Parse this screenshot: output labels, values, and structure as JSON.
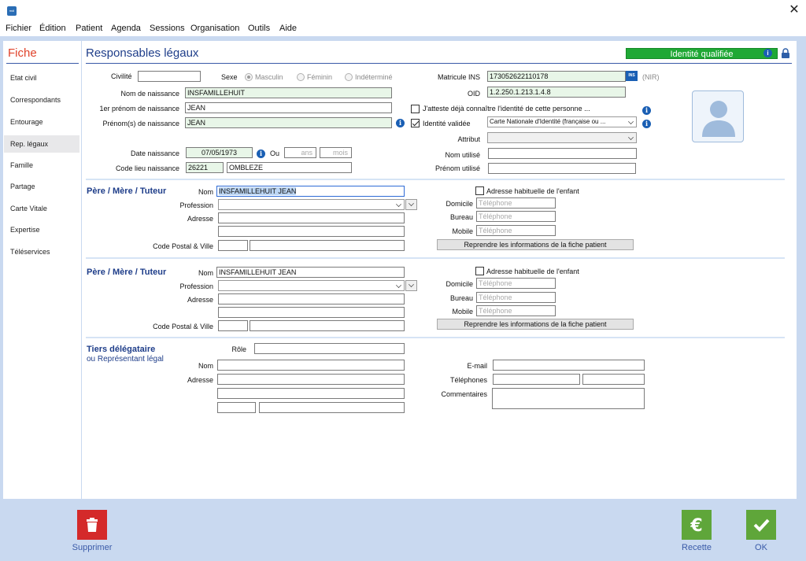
{
  "app": {
    "icon_text": "mdi"
  },
  "menu": [
    "Fichier",
    "Édition",
    "Patient",
    "Agenda",
    "Sessions",
    "Organisation",
    "Outils",
    "Aide"
  ],
  "left": {
    "title": "Fiche",
    "items": [
      "Etat civil",
      "Correspondants",
      "Entourage",
      "Rep. légaux",
      "Famille",
      "Partage",
      "Carte Vitale",
      "Expertise",
      "Téléservices"
    ]
  },
  "header": {
    "title": "Responsables légaux",
    "badge": "Identité qualifiée"
  },
  "identity": {
    "civilite_label": "Civilité",
    "civilite_value": "",
    "sexe_label": "Sexe",
    "sexe_options": [
      "Masculin",
      "Féminin",
      "Indéterminé"
    ],
    "nom_naissance_label": "Nom de naissance",
    "nom_naissance": "INSFAMILLEHUIT",
    "prenom1_label": "1er prénom de naissance",
    "prenom1": "JEAN",
    "prenoms_label": "Prénom(s) de naissance",
    "prenoms": "JEAN",
    "date_label": "Date naissance",
    "date": "07/05/1973",
    "ou_label": "Ou",
    "ans_placeholder": "ans",
    "mois_placeholder": "mois",
    "code_lieu_label": "Code lieu naissance",
    "code_lieu": "26221",
    "lieu": "OMBLEZE",
    "matricule_label": "Matricule INS",
    "matricule": "173052622110178",
    "ins_badge": "INS",
    "nir_label": "(NIR)",
    "oid_label": "OID",
    "oid": "1.2.250.1.213.1.4.8",
    "atteste_label": "J'atteste déjà connaître l'identité de cette personne ...",
    "validee_label": "Identité validée",
    "piece": "Carte Nationale d'Identité (française ou ...",
    "attribut_label": "Attribut",
    "attribut_value": "",
    "nom_utilise_label": "Nom utilisé",
    "nom_utilise": "",
    "prenom_utilise_label": "Prénom utilisé",
    "prenom_utilise": ""
  },
  "tuteur1": {
    "title": "Père / Mère / Tuteur",
    "nom_label": "Nom",
    "nom": "INSFAMILLEHUIT JEAN",
    "profession_label": "Profession",
    "adresse_label": "Adresse",
    "cp_label": "Code Postal & Ville",
    "adresse_habituelle": "Adresse habituelle de l'enfant",
    "domicile_label": "Domicile",
    "bureau_label": "Bureau",
    "mobile_label": "Mobile",
    "tel_placeholder": "Téléphone",
    "reprendre": "Reprendre les informations de la fiche patient"
  },
  "tuteur2": {
    "title": "Père / Mère / Tuteur",
    "nom_label": "Nom",
    "nom": "INSFAMILLEHUIT JEAN",
    "profession_label": "Profession",
    "adresse_label": "Adresse",
    "cp_label": "Code Postal & Ville",
    "adresse_habituelle": "Adresse habituelle de l'enfant",
    "domicile_label": "Domicile",
    "bureau_label": "Bureau",
    "mobile_label": "Mobile",
    "tel_placeholder": "Téléphone",
    "reprendre": "Reprendre les informations de la fiche patient"
  },
  "tiers": {
    "title": "Tiers délégataire",
    "subtitle": "ou Représentant légal",
    "role_label": "Rôle",
    "nom_label": "Nom",
    "adresse_label": "Adresse",
    "email_label": "E-mail",
    "telephones_label": "Téléphones",
    "commentaires_label": "Commentaires"
  },
  "footer": {
    "supprimer": "Supprimer",
    "recette": "Recette",
    "ok": "OK"
  },
  "colors": {
    "accent": "#1f3e8a",
    "fiche": "#e0432b",
    "qualified": "#1fa835",
    "delete": "#d42a2a",
    "confirm": "#5fa63a"
  }
}
